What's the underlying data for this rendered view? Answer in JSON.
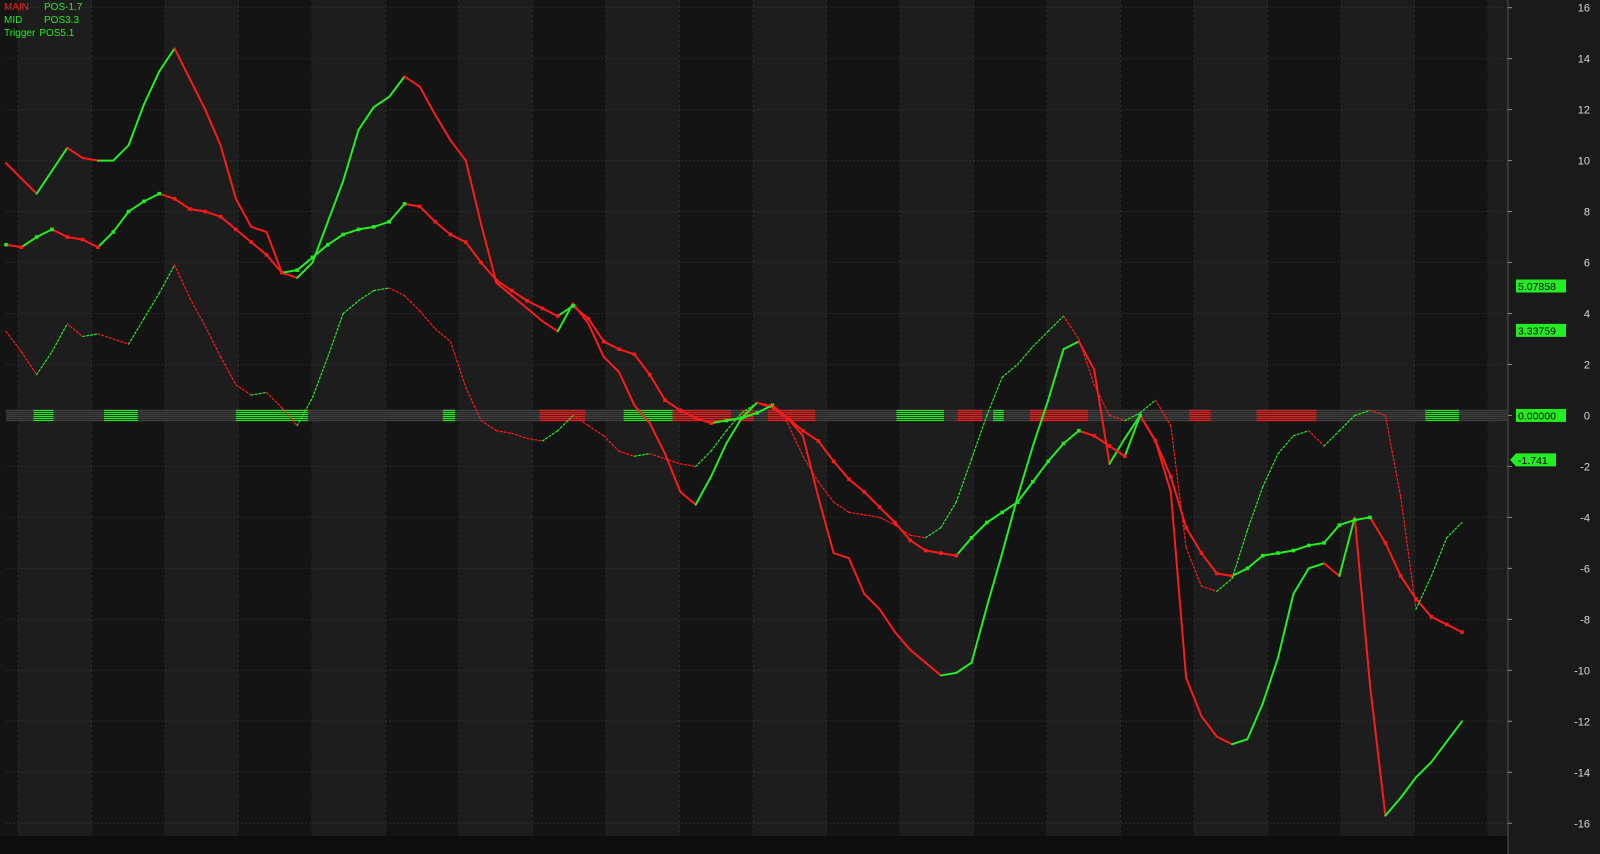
{
  "legend": {
    "main": {
      "name": "MAIN",
      "value": "POS-1.7"
    },
    "mid": {
      "name": "MID",
      "value": "POS3.3"
    },
    "trigger": {
      "name": "Trigger",
      "value": "POS5.1"
    }
  },
  "price_tags": [
    {
      "text": "5.07858",
      "value": 5.07858
    },
    {
      "text": "3.33759",
      "value": 3.33759
    },
    {
      "text": "0.00000",
      "value": 0
    },
    {
      "text": "-1.741",
      "value": -1.741
    }
  ],
  "colors": {
    "background": "#141414",
    "band_alt": "#1d1d1d",
    "grid": "#3a3a3a",
    "red": "#ff1a1a",
    "green": "#22ee22",
    "axis_text": "#d8d8d8"
  },
  "chart_data": {
    "type": "line",
    "title": "",
    "xlabel": "",
    "ylabel": "",
    "ylim": [
      -16.5,
      16.3
    ],
    "y_ticks": [
      "16",
      "14",
      "12",
      "10",
      "8",
      "6",
      "4",
      "2",
      "0",
      "-2",
      "-4",
      "-6",
      "-8",
      "-10",
      "-12",
      "-14",
      "-16"
    ],
    "grid": true,
    "legend_position": "top-left",
    "x_range": [
      0,
      98
    ],
    "series": [
      {
        "name": "MAIN",
        "style": "solid-two-color",
        "x": [
          0,
          1,
          2,
          3,
          4,
          5,
          6,
          7,
          8,
          9,
          10,
          11,
          12,
          13,
          14,
          15,
          16,
          17,
          18,
          19,
          20,
          21,
          22,
          23,
          24,
          25,
          26,
          27,
          28,
          29,
          30,
          31,
          32,
          33,
          34,
          35,
          36,
          37,
          38,
          39,
          40,
          41,
          42,
          43,
          44,
          45,
          46,
          47,
          48,
          49,
          50,
          51,
          52,
          53,
          54,
          55,
          56,
          57,
          58,
          59,
          60,
          61,
          62,
          63,
          64,
          65,
          66,
          67,
          68,
          69,
          70,
          71,
          72,
          73,
          74,
          75,
          76,
          77,
          78,
          79,
          80,
          81,
          82,
          83,
          84,
          85,
          86,
          87,
          88,
          89,
          90,
          91,
          92,
          93,
          94,
          95
        ],
        "y": [
          9.9,
          9.3,
          8.7,
          9.6,
          10.5,
          10.1,
          10.0,
          10.0,
          10.6,
          12.2,
          13.5,
          14.4,
          13.2,
          12.0,
          10.6,
          8.5,
          7.4,
          7.2,
          5.6,
          5.4,
          6.0,
          7.6,
          9.2,
          11.2,
          12.1,
          12.5,
          13.3,
          12.9,
          11.8,
          10.8,
          10.0,
          7.5,
          5.2,
          4.7,
          4.2,
          3.7,
          3.3,
          4.4,
          3.6,
          2.3,
          1.7,
          0.4,
          -0.3,
          -1.5,
          -3.0,
          -3.5,
          -2.4,
          -1.1,
          -0.1,
          0.5,
          0.3,
          -0.1,
          -0.8,
          -3.2,
          -5.4,
          -5.6,
          -7.0,
          -7.6,
          -8.5,
          -9.2,
          -9.7,
          -10.2,
          -10.1,
          -9.7,
          -7.5,
          -5.4,
          -3.2,
          -1.2,
          0.6,
          2.6,
          2.9,
          1.8,
          -1.9,
          -0.9,
          0.0,
          -1.0,
          -3.0,
          -10.3,
          -11.8,
          -12.6,
          -12.9,
          -12.7,
          -11.3,
          -9.5,
          -7.0,
          -6.0,
          -5.8,
          -6.3,
          -4.0,
          -10.6,
          -15.7,
          -15.0,
          -14.2,
          -13.6,
          -12.8,
          -12.0
        ]
      },
      {
        "name": "MID",
        "style": "solid-two-color-with-markers",
        "x": [
          0,
          1,
          2,
          3,
          4,
          5,
          6,
          7,
          8,
          9,
          10,
          11,
          12,
          13,
          14,
          15,
          16,
          17,
          18,
          19,
          20,
          21,
          22,
          23,
          24,
          25,
          26,
          27,
          28,
          29,
          30,
          31,
          32,
          33,
          34,
          35,
          36,
          37,
          38,
          39,
          40,
          41,
          42,
          43,
          44,
          45,
          46,
          47,
          48,
          49,
          50,
          51,
          52,
          53,
          54,
          55,
          56,
          57,
          58,
          59,
          60,
          61,
          62,
          63,
          64,
          65,
          66,
          67,
          68,
          69,
          70,
          71,
          72,
          73,
          74,
          75,
          76,
          77,
          78,
          79,
          80,
          81,
          82,
          83,
          84,
          85,
          86,
          87,
          88,
          89,
          90,
          91,
          92,
          93,
          94,
          95
        ],
        "y": [
          6.7,
          6.6,
          7.0,
          7.3,
          7.0,
          6.9,
          6.6,
          7.2,
          8.0,
          8.4,
          8.7,
          8.5,
          8.1,
          8.0,
          7.8,
          7.3,
          6.8,
          6.3,
          5.6,
          5.7,
          6.2,
          6.7,
          7.1,
          7.3,
          7.4,
          7.6,
          8.3,
          8.2,
          7.6,
          7.1,
          6.8,
          6.0,
          5.3,
          4.9,
          4.5,
          4.2,
          3.9,
          4.3,
          3.8,
          2.9,
          2.6,
          2.4,
          1.6,
          0.6,
          0.2,
          -0.1,
          -0.3,
          -0.2,
          -0.1,
          0.1,
          0.4,
          -0.1,
          -0.6,
          -1.0,
          -1.8,
          -2.5,
          -3.0,
          -3.6,
          -4.2,
          -4.9,
          -5.3,
          -5.4,
          -5.5,
          -4.8,
          -4.2,
          -3.8,
          -3.4,
          -2.6,
          -1.8,
          -1.1,
          -0.6,
          -0.8,
          -1.2,
          -1.6,
          0.0,
          -1.0,
          -2.4,
          -4.4,
          -5.4,
          -6.2,
          -6.3,
          -6.0,
          -5.5,
          -5.4,
          -5.3,
          -5.1,
          -5.0,
          -4.3,
          -4.1,
          -4.0,
          -5.0,
          -6.3,
          -7.2,
          -7.9,
          -8.2,
          -8.5
        ]
      },
      {
        "name": "Trigger",
        "style": "dotted-two-color",
        "x": [
          0,
          1,
          2,
          3,
          4,
          5,
          6,
          7,
          8,
          9,
          10,
          11,
          12,
          13,
          14,
          15,
          16,
          17,
          18,
          19,
          20,
          21,
          22,
          23,
          24,
          25,
          26,
          27,
          28,
          29,
          30,
          31,
          32,
          33,
          34,
          35,
          36,
          37,
          38,
          39,
          40,
          41,
          42,
          43,
          44,
          45,
          46,
          47,
          48,
          49,
          50,
          51,
          52,
          53,
          54,
          55,
          56,
          57,
          58,
          59,
          60,
          61,
          62,
          63,
          64,
          65,
          66,
          67,
          68,
          69,
          70,
          71,
          72,
          73,
          74,
          75,
          76,
          77,
          78,
          79,
          80,
          81,
          82,
          83,
          84,
          85,
          86,
          87,
          88,
          89,
          90,
          91,
          92,
          93,
          94,
          95
        ],
        "y": [
          3.3,
          2.5,
          1.6,
          2.5,
          3.6,
          3.1,
          3.2,
          3.0,
          2.8,
          3.8,
          4.8,
          5.9,
          4.6,
          3.5,
          2.3,
          1.2,
          0.8,
          0.9,
          0.3,
          -0.4,
          0.7,
          2.3,
          4.0,
          4.5,
          4.9,
          5.0,
          4.7,
          4.1,
          3.4,
          2.9,
          1.1,
          -0.2,
          -0.6,
          -0.7,
          -0.9,
          -1.0,
          -0.6,
          0.0,
          -0.4,
          -0.8,
          -1.4,
          -1.6,
          -1.5,
          -1.7,
          -1.9,
          -2.0,
          -1.4,
          -0.6,
          0.1,
          0.5,
          0.4,
          -0.3,
          -1.6,
          -2.6,
          -3.4,
          -3.8,
          -3.9,
          -4.0,
          -4.3,
          -4.7,
          -4.8,
          -4.4,
          -3.4,
          -1.7,
          0.0,
          1.5,
          2.0,
          2.7,
          3.3,
          3.9,
          3.0,
          1.2,
          0.0,
          -0.2,
          0.1,
          0.6,
          -0.4,
          -5.2,
          -6.7,
          -6.9,
          -6.4,
          -4.5,
          -2.8,
          -1.5,
          -0.8,
          -0.6,
          -1.2,
          -0.6,
          0.0,
          0.2,
          0.0,
          -3.2,
          -7.6,
          -6.3,
          -4.8,
          -4.2
        ]
      }
    ],
    "zero_band_segments": [
      {
        "color": "green",
        "from": 1.8,
        "to": 3.1
      },
      {
        "color": "green",
        "from": 6.4,
        "to": 8.6
      },
      {
        "color": "green",
        "from": 15.0,
        "to": 19.7
      },
      {
        "color": "green",
        "from": 28.5,
        "to": 29.3
      },
      {
        "color": "red",
        "from": 34.8,
        "to": 37.8
      },
      {
        "color": "green",
        "from": 40.3,
        "to": 43.5
      },
      {
        "color": "red",
        "from": 43.5,
        "to": 47.3
      },
      {
        "color": "red",
        "from": 48.0,
        "to": 48.8
      },
      {
        "color": "red",
        "from": 49.7,
        "to": 52.8
      },
      {
        "color": "green",
        "from": 58.1,
        "to": 61.2
      },
      {
        "color": "red",
        "from": 62.1,
        "to": 63.7
      },
      {
        "color": "green",
        "from": 64.4,
        "to": 65.1
      },
      {
        "color": "red",
        "from": 66.8,
        "to": 70.6
      },
      {
        "color": "red",
        "from": 77.2,
        "to": 78.6
      },
      {
        "color": "red",
        "from": 81.6,
        "to": 85.5
      },
      {
        "color": "green",
        "from": 92.6,
        "to": 94.8
      }
    ]
  }
}
